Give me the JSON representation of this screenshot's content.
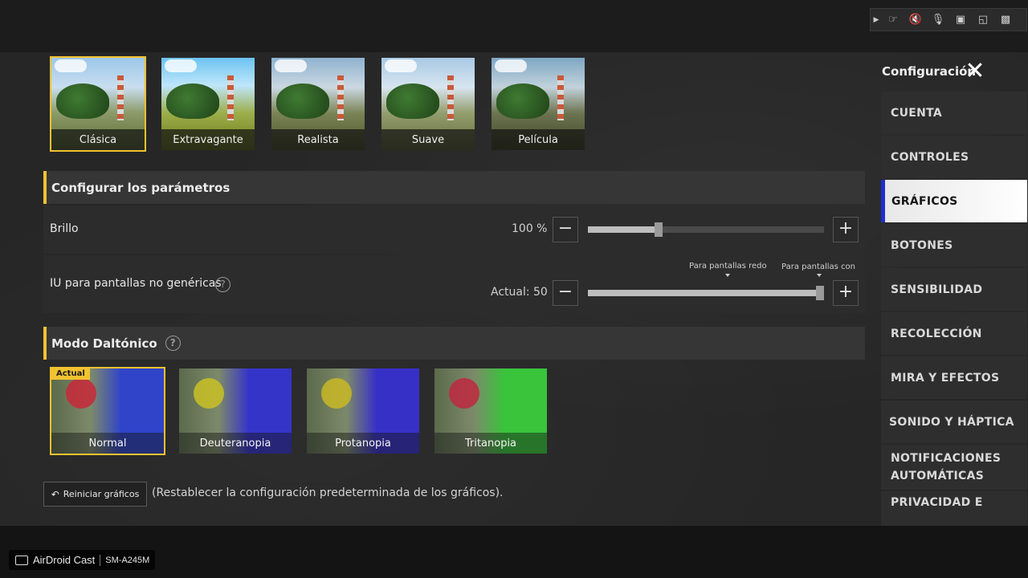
{
  "cast_toolbar": {
    "icons": [
      "play-arrow-icon",
      "hand-pointer-icon",
      "speaker-muted-icon",
      "mic-muted-icon",
      "file-icon",
      "fullscreen-icon",
      "screen-icon"
    ]
  },
  "presets": [
    {
      "label": "Clásica",
      "selected": true
    },
    {
      "label": "Extravagante",
      "selected": false
    },
    {
      "label": "Realista",
      "selected": false
    },
    {
      "label": "Suave",
      "selected": false
    },
    {
      "label": "Película",
      "selected": false
    }
  ],
  "params": {
    "title": "Configurar los parámetros",
    "brightness": {
      "label": "Brillo",
      "value_text": "100 %",
      "level": 0.3
    },
    "ui_screens": {
      "label": "IU para pantallas no genéricas",
      "value_text": "Actual: 50",
      "level": 1.0,
      "tick_rounded": "Para pantallas redo",
      "tick_with": "Para pantallas con"
    }
  },
  "colorblind": {
    "title": "Modo Daltónico",
    "current_badge": "Actual",
    "options": [
      {
        "label": "Normal",
        "selected": true,
        "circle": "#c8283a",
        "tint": "#2f44c9"
      },
      {
        "label": "Deuteranopia",
        "selected": false,
        "circle": "#c9c126",
        "tint": "#3534c9"
      },
      {
        "label": "Protanopia",
        "selected": false,
        "circle": "#c9b926",
        "tint": "#3730c7"
      },
      {
        "label": "Tritanopia",
        "selected": false,
        "circle": "#c0283e",
        "tint": "#39c43c"
      }
    ]
  },
  "reset": {
    "button_label": "Reiniciar gráficos",
    "description": "(Restablecer la configuración predeterminada de los gráficos)."
  },
  "nav": {
    "title": "Configuración",
    "items": [
      {
        "label": "CUENTA",
        "active": false
      },
      {
        "label": "CONTROLES",
        "active": false
      },
      {
        "label": "GRÁFICOS",
        "active": true
      },
      {
        "label": "BOTONES",
        "active": false
      },
      {
        "label": "SENSIBILIDAD",
        "active": false
      },
      {
        "label": "RECOLECCIÓN",
        "active": false
      },
      {
        "label": "MIRA Y EFECTOS",
        "active": false
      },
      {
        "label": "SONIDO Y HÁPTICA",
        "active": false
      },
      {
        "label": "NOTIFICACIONES",
        "label2": "AUTOMÁTICAS",
        "active": false
      },
      {
        "label": "PRIVACIDAD E",
        "active": false
      }
    ]
  },
  "watermark": {
    "app": "AirDroid Cast",
    "device": "SM-A245M"
  },
  "colors": {
    "accent": "#f2c230",
    "nav_active_bar": "#1c2fcf"
  }
}
